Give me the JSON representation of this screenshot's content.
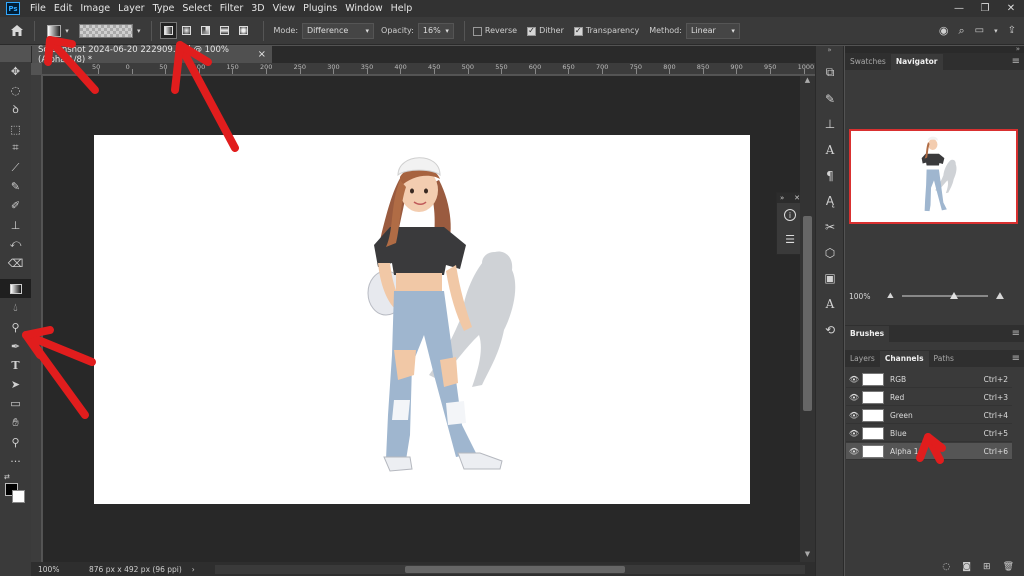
{
  "app": {
    "logo": "Ps"
  },
  "menu": [
    "File",
    "Edit",
    "Image",
    "Layer",
    "Type",
    "Select",
    "Filter",
    "3D",
    "View",
    "Plugins",
    "Window",
    "Help"
  ],
  "window_controls": [
    "—",
    "❐",
    "✕"
  ],
  "options": {
    "mode_label": "Mode:",
    "mode_value": "Difference",
    "opacity_label": "Opacity:",
    "opacity_value": "16%",
    "reverse_label": "Reverse",
    "dither_label": "Dither",
    "transparency_label": "Transparency",
    "method_label": "Method:",
    "method_value": "Linear",
    "reverse_checked": false,
    "dither_checked": true,
    "transparency_checked": true
  },
  "document": {
    "tab_title": "Screenshot 2024-06-20 222909.psd @ 100% (Alpha 1/8) *",
    "tab_close": "×",
    "status_zoom": "100%",
    "status_info": "876 px x 492 px (96 ppi)"
  },
  "ruler": {
    "h_ticks": [
      "50",
      "0",
      "50",
      "100",
      "150",
      "200",
      "250",
      "300",
      "350",
      "400",
      "450",
      "500",
      "550",
      "600",
      "650",
      "700",
      "750",
      "800",
      "850",
      "900",
      "950",
      "1000"
    ]
  },
  "panels": {
    "top_tabs": [
      "Swatches",
      "Navigator"
    ],
    "navigator_zoom": "100%",
    "brushes_tab": "Brushes",
    "lower_tabs": [
      "Layers",
      "Channels",
      "Paths"
    ],
    "channels": [
      {
        "name": "RGB",
        "shortcut": "Ctrl+2"
      },
      {
        "name": "Red",
        "shortcut": "Ctrl+3"
      },
      {
        "name": "Green",
        "shortcut": "Ctrl+4"
      },
      {
        "name": "Blue",
        "shortcut": "Ctrl+5"
      },
      {
        "name": "Alpha 1",
        "shortcut": "Ctrl+6"
      }
    ]
  },
  "colors": {
    "annotation_red": "#e11d1d",
    "navigator_frame": "#d93030",
    "app_bg": "#535353"
  },
  "icons": {
    "tools": [
      "move-icon",
      "marquee-icon",
      "lasso-icon",
      "object-select-icon",
      "crop-icon",
      "eyedropper-icon",
      "healing-brush-icon",
      "brush-icon",
      "clone-stamp-icon",
      "history-brush-icon",
      "eraser-icon",
      "gradient-icon",
      "blur-icon",
      "dodge-icon",
      "pen-icon",
      "type-icon",
      "path-select-icon",
      "rectangle-icon",
      "hand-icon",
      "zoom-icon",
      "more-tools-icon"
    ],
    "strip": [
      "history-icon",
      "brush-settings-icon",
      "clone-source-icon",
      "character-icon",
      "paragraph-icon",
      "glyphs-icon",
      "tool-presets-icon",
      "3d-icon",
      "properties-icon",
      "actions-icon",
      "timeline-icon"
    ]
  }
}
